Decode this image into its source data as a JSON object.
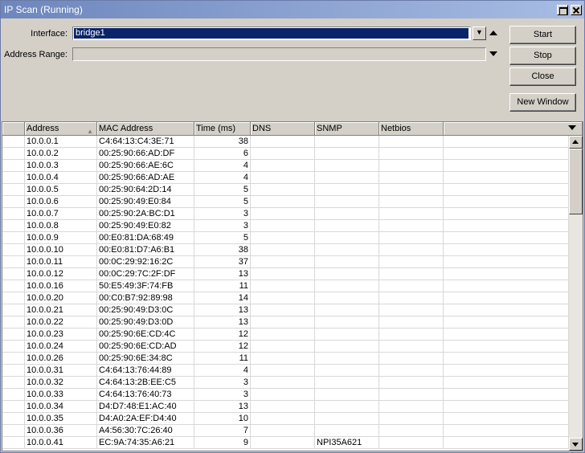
{
  "window": {
    "title": "IP Scan (Running)"
  },
  "form": {
    "interface_label": "Interface:",
    "interface_value": "bridge1",
    "address_range_label": "Address Range:",
    "address_range_value": ""
  },
  "buttons": {
    "start": "Start",
    "stop": "Stop",
    "close": "Close",
    "new_window": "New Window"
  },
  "table": {
    "columns": [
      "",
      "Address",
      "MAC Address",
      "Time (ms)",
      "DNS",
      "SNMP",
      "Netbios",
      ""
    ],
    "sorted_column": "Address",
    "rows": [
      {
        "address": "10.0.0.1",
        "mac": "C4:64:13:C4:3E:71",
        "time": "38",
        "dns": "",
        "snmp": "",
        "netbios": ""
      },
      {
        "address": "10.0.0.2",
        "mac": "00:25:90:66:AD:DF",
        "time": "6",
        "dns": "",
        "snmp": "",
        "netbios": ""
      },
      {
        "address": "10.0.0.3",
        "mac": "00:25:90:66:AE:6C",
        "time": "4",
        "dns": "",
        "snmp": "",
        "netbios": ""
      },
      {
        "address": "10.0.0.4",
        "mac": "00:25:90:66:AD:AE",
        "time": "4",
        "dns": "",
        "snmp": "",
        "netbios": ""
      },
      {
        "address": "10.0.0.5",
        "mac": "00:25:90:64:2D:14",
        "time": "5",
        "dns": "",
        "snmp": "",
        "netbios": ""
      },
      {
        "address": "10.0.0.6",
        "mac": "00:25:90:49:E0:84",
        "time": "5",
        "dns": "",
        "snmp": "",
        "netbios": ""
      },
      {
        "address": "10.0.0.7",
        "mac": "00:25:90:2A:BC:D1",
        "time": "3",
        "dns": "",
        "snmp": "",
        "netbios": ""
      },
      {
        "address": "10.0.0.8",
        "mac": "00:25:90:49:E0:82",
        "time": "3",
        "dns": "",
        "snmp": "",
        "netbios": ""
      },
      {
        "address": "10.0.0.9",
        "mac": "00:E0:81:DA:68:49",
        "time": "5",
        "dns": "",
        "snmp": "",
        "netbios": ""
      },
      {
        "address": "10.0.0.10",
        "mac": "00:E0:81:D7:A6:B1",
        "time": "38",
        "dns": "",
        "snmp": "",
        "netbios": ""
      },
      {
        "address": "10.0.0.11",
        "mac": "00:0C:29:92:16:2C",
        "time": "37",
        "dns": "",
        "snmp": "",
        "netbios": ""
      },
      {
        "address": "10.0.0.12",
        "mac": "00:0C:29:7C:2F:DF",
        "time": "13",
        "dns": "",
        "snmp": "",
        "netbios": ""
      },
      {
        "address": "10.0.0.16",
        "mac": "50:E5:49:3F:74:FB",
        "time": "11",
        "dns": "",
        "snmp": "",
        "netbios": ""
      },
      {
        "address": "10.0.0.20",
        "mac": "00:C0:B7:92:89:98",
        "time": "14",
        "dns": "",
        "snmp": "",
        "netbios": ""
      },
      {
        "address": "10.0.0.21",
        "mac": "00:25:90:49:D3:0C",
        "time": "13",
        "dns": "",
        "snmp": "",
        "netbios": ""
      },
      {
        "address": "10.0.0.22",
        "mac": "00:25:90:49:D3:0D",
        "time": "13",
        "dns": "",
        "snmp": "",
        "netbios": ""
      },
      {
        "address": "10.0.0.23",
        "mac": "00:25:90:6E:CD:4C",
        "time": "12",
        "dns": "",
        "snmp": "",
        "netbios": ""
      },
      {
        "address": "10.0.0.24",
        "mac": "00:25:90:6E:CD:AD",
        "time": "12",
        "dns": "",
        "snmp": "",
        "netbios": ""
      },
      {
        "address": "10.0.0.26",
        "mac": "00:25:90:6E:34:8C",
        "time": "11",
        "dns": "",
        "snmp": "",
        "netbios": ""
      },
      {
        "address": "10.0.0.31",
        "mac": "C4:64:13:76:44:89",
        "time": "4",
        "dns": "",
        "snmp": "",
        "netbios": ""
      },
      {
        "address": "10.0.0.32",
        "mac": "C4:64:13:2B:EE:C5",
        "time": "3",
        "dns": "",
        "snmp": "",
        "netbios": ""
      },
      {
        "address": "10.0.0.33",
        "mac": "C4:64:13:76:40:73",
        "time": "3",
        "dns": "",
        "snmp": "",
        "netbios": ""
      },
      {
        "address": "10.0.0.34",
        "mac": "D4:D7:48:E1:AC:40",
        "time": "13",
        "dns": "",
        "snmp": "",
        "netbios": ""
      },
      {
        "address": "10.0.0.35",
        "mac": "D4:A0:2A:EF:D4:40",
        "time": "10",
        "dns": "",
        "snmp": "",
        "netbios": ""
      },
      {
        "address": "10.0.0.36",
        "mac": "A4:56:30:7C:26:40",
        "time": "7",
        "dns": "",
        "snmp": "",
        "netbios": ""
      },
      {
        "address": "10.0.0.41",
        "mac": "EC:9A:74:35:A6:21",
        "time": "9",
        "dns": "",
        "snmp": "NPI35A621",
        "netbios": ""
      }
    ]
  }
}
